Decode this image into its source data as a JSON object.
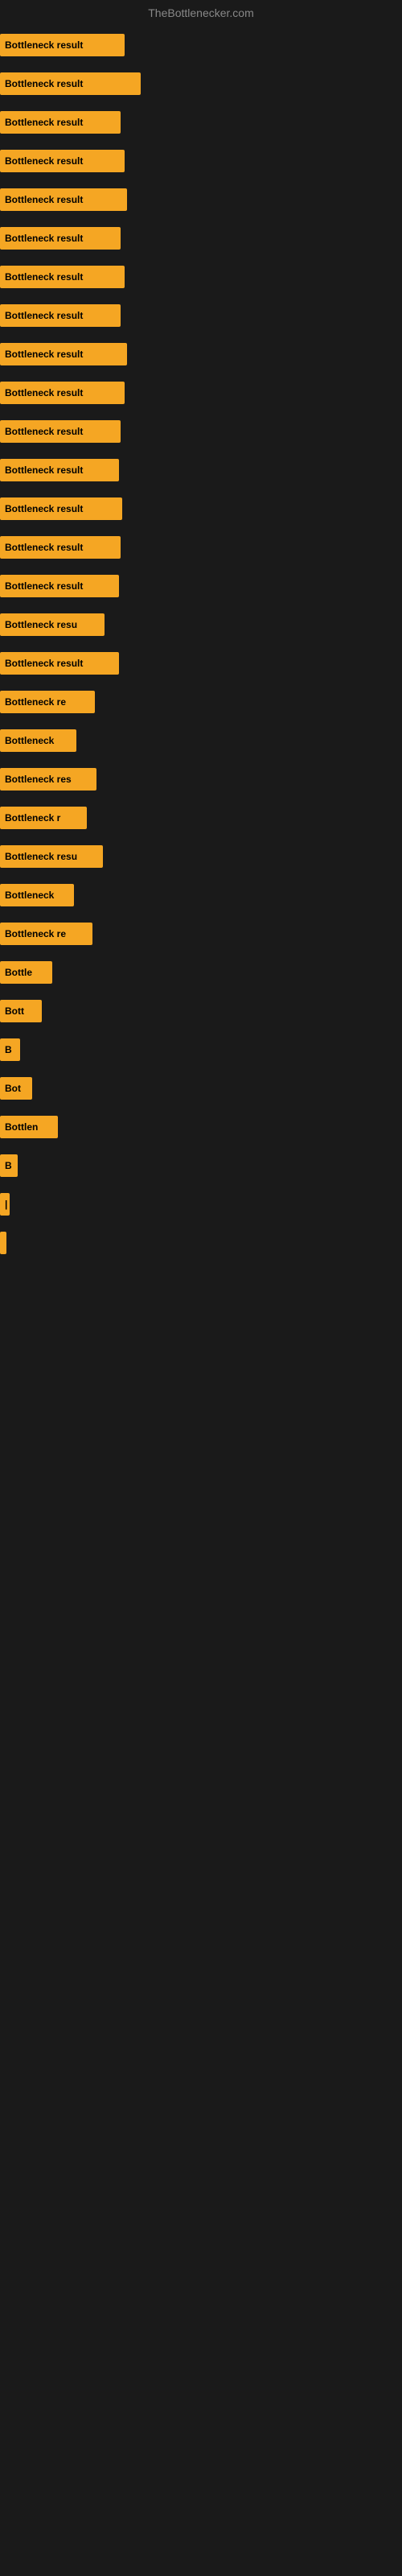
{
  "site": {
    "title": "TheBottlenecker.com"
  },
  "bars": [
    {
      "label": "Bottleneck result",
      "width": 155
    },
    {
      "label": "Bottleneck result",
      "width": 175
    },
    {
      "label": "Bottleneck result",
      "width": 150
    },
    {
      "label": "Bottleneck result",
      "width": 155
    },
    {
      "label": "Bottleneck result",
      "width": 158
    },
    {
      "label": "Bottleneck result",
      "width": 150
    },
    {
      "label": "Bottleneck result",
      "width": 155
    },
    {
      "label": "Bottleneck result",
      "width": 150
    },
    {
      "label": "Bottleneck result",
      "width": 158
    },
    {
      "label": "Bottleneck result",
      "width": 155
    },
    {
      "label": "Bottleneck result",
      "width": 150
    },
    {
      "label": "Bottleneck result",
      "width": 148
    },
    {
      "label": "Bottleneck result",
      "width": 152
    },
    {
      "label": "Bottleneck result",
      "width": 150
    },
    {
      "label": "Bottleneck result",
      "width": 148
    },
    {
      "label": "Bottleneck resu",
      "width": 130
    },
    {
      "label": "Bottleneck result",
      "width": 148
    },
    {
      "label": "Bottleneck re",
      "width": 118
    },
    {
      "label": "Bottleneck",
      "width": 95
    },
    {
      "label": "Bottleneck res",
      "width": 120
    },
    {
      "label": "Bottleneck r",
      "width": 108
    },
    {
      "label": "Bottleneck resu",
      "width": 128
    },
    {
      "label": "Bottleneck",
      "width": 92
    },
    {
      "label": "Bottleneck re",
      "width": 115
    },
    {
      "label": "Bottle",
      "width": 65
    },
    {
      "label": "Bott",
      "width": 52
    },
    {
      "label": "B",
      "width": 25
    },
    {
      "label": "Bot",
      "width": 40
    },
    {
      "label": "Bottlen",
      "width": 72
    },
    {
      "label": "B",
      "width": 22
    },
    {
      "label": "|",
      "width": 12
    },
    {
      "label": "",
      "width": 8
    },
    {
      "label": "",
      "width": 0
    },
    {
      "label": "",
      "width": 0
    },
    {
      "label": "",
      "width": 0
    }
  ]
}
